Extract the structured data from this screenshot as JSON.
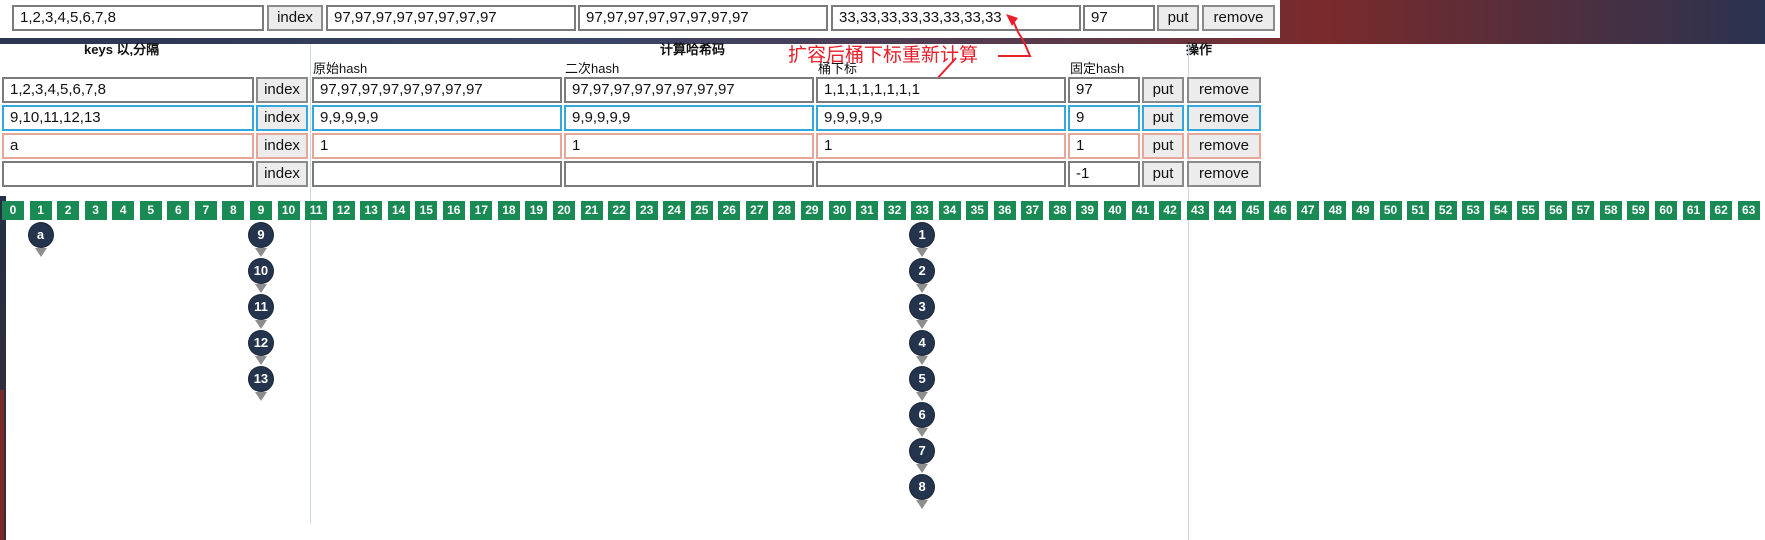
{
  "top_row": {
    "keys": "1,2,3,4,5,6,7,8",
    "index_label": "index",
    "original_hash": "97,97,97,97,97,97,97,97",
    "secondary_hash": "97,97,97,97,97,97,97,97",
    "bucket_index": "33,33,33,33,33,33,33,33",
    "fixed_hash": "97",
    "put_label": "put",
    "remove_label": "remove"
  },
  "headers": {
    "keys": "keys 以,分隔",
    "compute": "计算哈希码",
    "original_hash": "原始hash",
    "secondary_hash": "二次hash",
    "bucket_index": "桶下标",
    "fixed_hash": "固定hash",
    "ops": "操作"
  },
  "annotation": "扩容后桶下标重新计算",
  "rows": [
    {
      "keys": "1,2,3,4,5,6,7,8",
      "index": "index",
      "original_hash": "97,97,97,97,97,97,97,97",
      "secondary_hash": "97,97,97,97,97,97,97,97",
      "bucket_index": "1,1,1,1,1,1,1,1",
      "fixed_hash": "97",
      "put": "put",
      "remove": "remove"
    },
    {
      "keys": "9,10,11,12,13",
      "index": "index",
      "original_hash": "9,9,9,9,9",
      "secondary_hash": "9,9,9,9,9",
      "bucket_index": "9,9,9,9,9",
      "fixed_hash": "9",
      "put": "put",
      "remove": "remove"
    },
    {
      "keys": "a",
      "index": "index",
      "original_hash": "1",
      "secondary_hash": "1",
      "bucket_index": "1",
      "fixed_hash": "1",
      "put": "put",
      "remove": "remove"
    },
    {
      "keys": "",
      "index": "index",
      "original_hash": "",
      "secondary_hash": "",
      "bucket_index": "",
      "fixed_hash": "-1",
      "put": "put",
      "remove": "remove"
    }
  ],
  "bucket_labels": [
    "0",
    "1",
    "2",
    "3",
    "4",
    "5",
    "6",
    "7",
    "8",
    "9",
    "10",
    "11",
    "12",
    "13",
    "14",
    "15",
    "16",
    "17",
    "18",
    "19",
    "20",
    "21",
    "22",
    "23",
    "24",
    "25",
    "26",
    "27",
    "28",
    "29",
    "30",
    "31",
    "32",
    "33",
    "34",
    "35",
    "36",
    "37",
    "38",
    "39",
    "40",
    "41",
    "42",
    "43",
    "44",
    "45",
    "46",
    "47",
    "48",
    "49",
    "50",
    "51",
    "52",
    "53",
    "54",
    "55",
    "56",
    "57",
    "58",
    "59",
    "60",
    "61",
    "62",
    "63"
  ],
  "chains": [
    {
      "bucket": 1,
      "nodes": [
        "a"
      ]
    },
    {
      "bucket": 9,
      "nodes": [
        "9",
        "10",
        "11",
        "12",
        "13"
      ]
    },
    {
      "bucket": 33,
      "nodes": [
        "1",
        "2",
        "3",
        "4",
        "5",
        "6",
        "7",
        "8"
      ]
    }
  ],
  "colors": {
    "bucket_bg": "#1a8a55",
    "node_bg": "#24344d",
    "annotation": "#e8202a",
    "row_blue": "#35a7df",
    "row_red": "#e6a79b"
  }
}
